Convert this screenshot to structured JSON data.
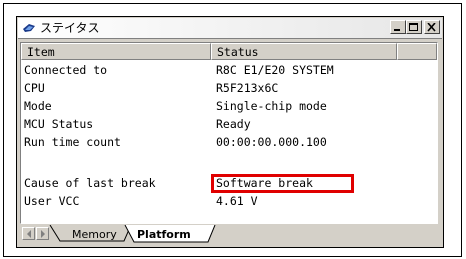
{
  "window": {
    "title": "ステイタス"
  },
  "table": {
    "columns": [
      "Item",
      "Status"
    ],
    "rows": [
      {
        "item": "Connected to",
        "status": "R8C E1/E20 SYSTEM"
      },
      {
        "item": "CPU",
        "status": "R5F213x6C"
      },
      {
        "item": "Mode",
        "status": "Single-chip mode"
      },
      {
        "item": "MCU Status",
        "status": "Ready"
      },
      {
        "item": "Run time count",
        "status": "00:00:00.000.100"
      },
      {
        "item": "Cause of last break",
        "status": "Software break"
      },
      {
        "item": "User VCC",
        "status": "4.61 V"
      }
    ]
  },
  "tabs": [
    "Memory",
    "Platform"
  ],
  "active_tab": "Platform",
  "highlight_color": "#e00000"
}
